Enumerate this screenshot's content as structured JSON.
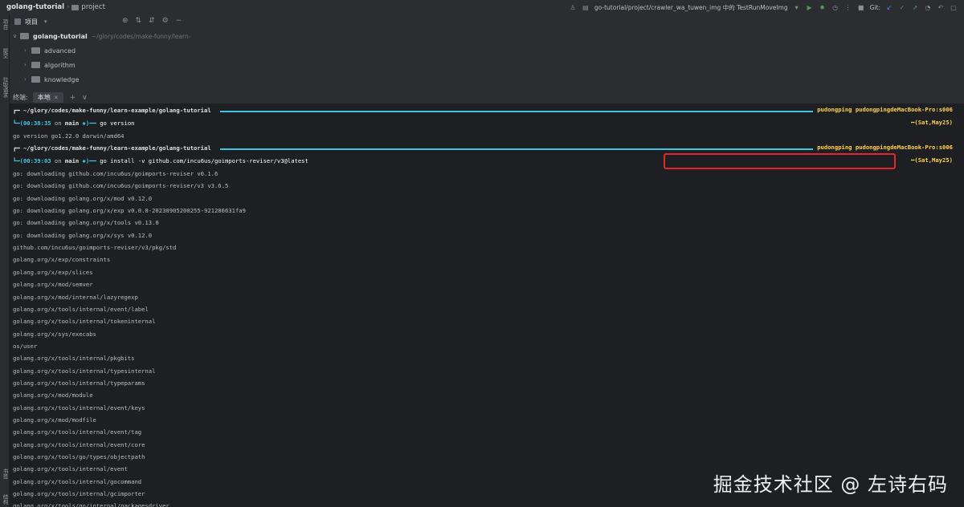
{
  "topbar": {
    "project": "golang-tutorial",
    "folder": "project",
    "run_config": "go-tutorial/project/crawler_wa_tuwen_img 中的 TestRunMoveImg",
    "git_label": "Git:"
  },
  "left_strip": {
    "tab_project": "项目",
    "tab_commit": "提交",
    "tab_pull": "拉取请求",
    "tab_bookmarks": "书签",
    "tab_structure": "结构"
  },
  "project_panel": {
    "title": "项目",
    "dropdown": "▾",
    "root": "golang-tutorial",
    "root_path": "~/glory/codes/make-funny/learn-",
    "items": [
      "advanced",
      "algorithm",
      "knowledge"
    ]
  },
  "terminal": {
    "label": "终端:",
    "tab_name": "本地",
    "prompt1": {
      "path": "┏━ ~/glory/codes/make-funny/learn-example/golang-tutorial",
      "user": "pudongping pudongpingdeMacBook-Pro:s006",
      "time": "┗━(00:38:35",
      "on": " on ",
      "branch": "main",
      "mark": " ✱)━━",
      "cmd": " go version",
      "date": "━(Sat,May25)"
    },
    "output1": "go version go1.22.0 darwin/amd64",
    "prompt2": {
      "path": "┏━ ~/glory/codes/make-funny/learn-example/golang-tutorial",
      "user": "pudongping pudongpingdeMacBook-Pro:s006",
      "time": "┗━(00:39:03",
      "on": " on ",
      "branch": "main",
      "mark": " ✱)━━",
      "cmd": " go install -v github.com/incu6us/goimports-reviser/v3@latest",
      "date": "━(Sat,May25)"
    },
    "lines": [
      "go: downloading github.com/incu6us/goimports-reviser v0.1.6",
      "go: downloading github.com/incu6us/goimports-reviser/v3 v3.6.5",
      "go: downloading golang.org/x/mod v0.12.0",
      "go: downloading golang.org/x/exp v0.0.0-20230905200255-921286631fa9",
      "go: downloading golang.org/x/tools v0.13.0",
      "go: downloading golang.org/x/sys v0.12.0",
      "github.com/incu6us/goimports-reviser/v3/pkg/std",
      "golang.org/x/exp/constraints",
      "golang.org/x/exp/slices",
      "golang.org/x/mod/semver",
      "golang.org/x/mod/internal/lazyregexp",
      "golang.org/x/tools/internal/event/label",
      "golang.org/x/tools/internal/tokeninternal",
      "golang.org/x/sys/execabs",
      "os/user",
      "golang.org/x/tools/internal/pkgbits",
      "golang.org/x/tools/internal/typesinternal",
      "golang.org/x/tools/internal/typeparams",
      "golang.org/x/mod/module",
      "golang.org/x/tools/internal/event/keys",
      "golang.org/x/mod/modfile",
      "golang.org/x/tools/internal/event/tag",
      "golang.org/x/tools/internal/event/core",
      "golang.org/x/tools/go/types/objectpath",
      "golang.org/x/tools/internal/event",
      "golang.org/x/tools/internal/gocommand",
      "golang.org/x/tools/internal/gcimporter",
      "golang.org/x/tools/go/internal/packagesdriver"
    ]
  },
  "watermark": "掘金技术社区 @ 左诗右码"
}
